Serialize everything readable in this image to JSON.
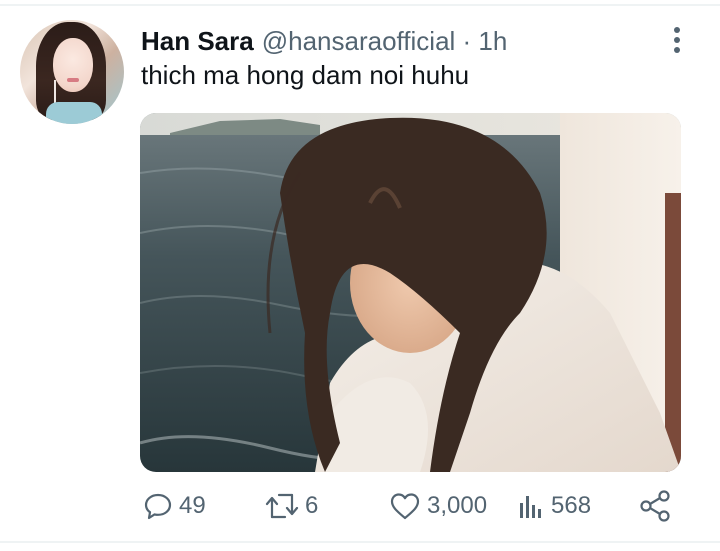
{
  "tweet": {
    "display_name": "Han Sara",
    "handle": "@hansaraofficial",
    "separator": " · ",
    "time": "1h",
    "text": "thich ma hong dam noi huhu"
  },
  "icons": {
    "more": "more-vertical-icon",
    "reply": "speech-bubble-icon",
    "retweet": "retweet-icon",
    "like": "heart-icon",
    "views": "bar-chart-icon",
    "share": "share-icon"
  },
  "actions": {
    "replies": "49",
    "retweets": "6",
    "likes": "3,000",
    "views": "568"
  },
  "colors": {
    "text": "#0f1419",
    "secondary": "#536471",
    "divider": "#eff3f4"
  }
}
